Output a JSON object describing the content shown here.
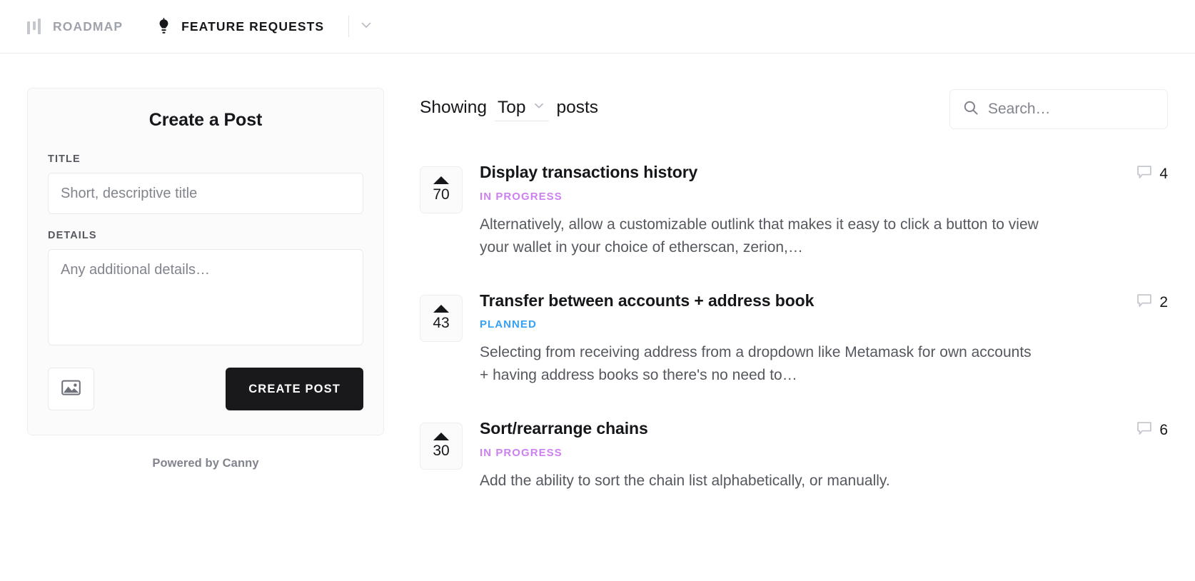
{
  "nav": {
    "items": [
      {
        "label": "ROADMAP",
        "icon": "roadmap-bars-icon",
        "active": false
      },
      {
        "label": "FEATURE REQUESTS",
        "icon": "lightbulb-icon",
        "active": true
      }
    ],
    "caret_icon": "chevron-down-icon"
  },
  "create_post": {
    "heading": "Create a Post",
    "title_label": "TITLE",
    "title_placeholder": "Short, descriptive title",
    "title_value": "",
    "details_label": "DETAILS",
    "details_placeholder": "Any additional details…",
    "details_value": "",
    "image_button_icon": "image-icon",
    "submit_label": "CREATE POST",
    "powered_by": "Powered by Canny"
  },
  "list_header": {
    "showing_prefix": "Showing",
    "sort_value": "Top",
    "sort_caret_icon": "chevron-down-icon",
    "showing_suffix": "posts",
    "search_icon": "search-icon",
    "search_placeholder": "Search…",
    "search_value": ""
  },
  "colors": {
    "in_progress": "#cd80f0",
    "planned": "#36a1f7",
    "text_primary": "#15171a",
    "text_muted": "#55585f",
    "button_dark": "#19191b"
  },
  "posts": [
    {
      "votes": "70",
      "title": "Display transactions history",
      "status": "IN PROGRESS",
      "status_color": "#cd80f0",
      "description": "Alternatively, allow a customizable outlink that makes it easy to click a button to view your wallet in your choice of etherscan, zerion,…",
      "comments": "4",
      "comment_icon": "comment-bubble-icon",
      "vote_icon": "upvote-arrow-icon"
    },
    {
      "votes": "43",
      "title": "Transfer between accounts + address book",
      "status": "PLANNED",
      "status_color": "#36a1f7",
      "description": "Selecting from receiving address from a dropdown like Metamask for own accounts + having address books so there's no need to…",
      "comments": "2",
      "comment_icon": "comment-bubble-icon",
      "vote_icon": "upvote-arrow-icon"
    },
    {
      "votes": "30",
      "title": "Sort/rearrange chains",
      "status": "IN PROGRESS",
      "status_color": "#cd80f0",
      "description": "Add the ability to sort the chain list alphabetically, or manually.",
      "comments": "6",
      "comment_icon": "comment-bubble-icon",
      "vote_icon": "upvote-arrow-icon"
    }
  ]
}
